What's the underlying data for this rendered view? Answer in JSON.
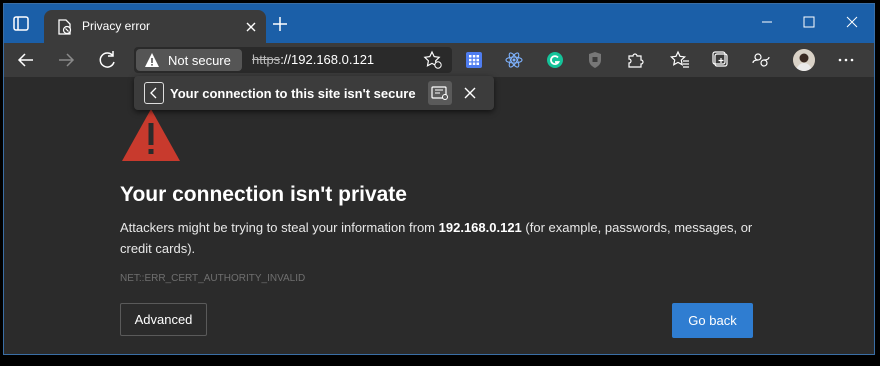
{
  "browser": {
    "tab_title": "Privacy error",
    "security_label": "Not secure",
    "url_scheme": "https",
    "url_rest": "://192.168.0.121",
    "accent_color": "#1b5fa8",
    "popup_message": "Your connection to this site isn't secure"
  },
  "page": {
    "heading": "Your connection isn't private",
    "desc_prefix": "Attackers might be trying to steal your information from ",
    "desc_host": "192.168.0.121",
    "desc_suffix": " (for example, passwords, messages, or credit cards).",
    "error_code": "NET::ERR_CERT_AUTHORITY_INVALID",
    "advanced_label": "Advanced",
    "goback_label": "Go back",
    "warning_color": "#c83a2d",
    "button_color": "#2f7dd1"
  },
  "icons": [
    "tab-actions-icon",
    "site-favicon-icon",
    "close-tab-icon",
    "new-tab-icon",
    "minimize-icon",
    "maximize-icon",
    "close-window-icon",
    "back-icon",
    "forward-icon",
    "refresh-icon",
    "warning-triangle-icon",
    "favorite-add-icon",
    "apps-grid-icon",
    "react-extension-icon",
    "grammarly-icon",
    "shield-extension-icon",
    "extensions-puzzle-icon",
    "favorites-icon",
    "collections-icon",
    "profile-sync-icon",
    "profile-avatar",
    "more-menu-icon",
    "certificate-icon",
    "close-popup-icon",
    "chevron-left-icon"
  ]
}
